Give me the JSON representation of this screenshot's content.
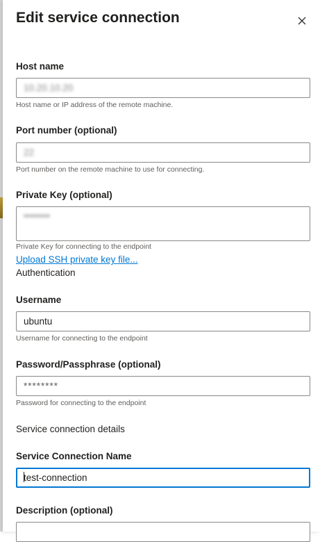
{
  "panel": {
    "title": "Edit service connection"
  },
  "fields": {
    "host": {
      "label": "Host name",
      "value": "10.20.10.20",
      "help": "Host name or IP address of the remote machine."
    },
    "port": {
      "label": "Port number (optional)",
      "value": "22",
      "help": "Port number on the remote machine to use for connecting."
    },
    "private_key": {
      "label": "Private Key (optional)",
      "value": "••••••••",
      "help": "Private Key for connecting to the endpoint",
      "upload_link": "Upload SSH private key file..."
    },
    "authentication_section": "Authentication",
    "username": {
      "label": "Username",
      "value": "ubuntu",
      "help": "Username for connecting to the endpoint"
    },
    "password": {
      "label": "Password/Passphrase (optional)",
      "value": "********",
      "help": "Password for connecting to the endpoint"
    },
    "details_section": "Service connection details",
    "connection_name": {
      "label": "Service Connection Name",
      "value": "test-connection"
    },
    "description": {
      "label": "Description (optional)",
      "value": ""
    }
  },
  "icons": {
    "close": "close-icon"
  }
}
